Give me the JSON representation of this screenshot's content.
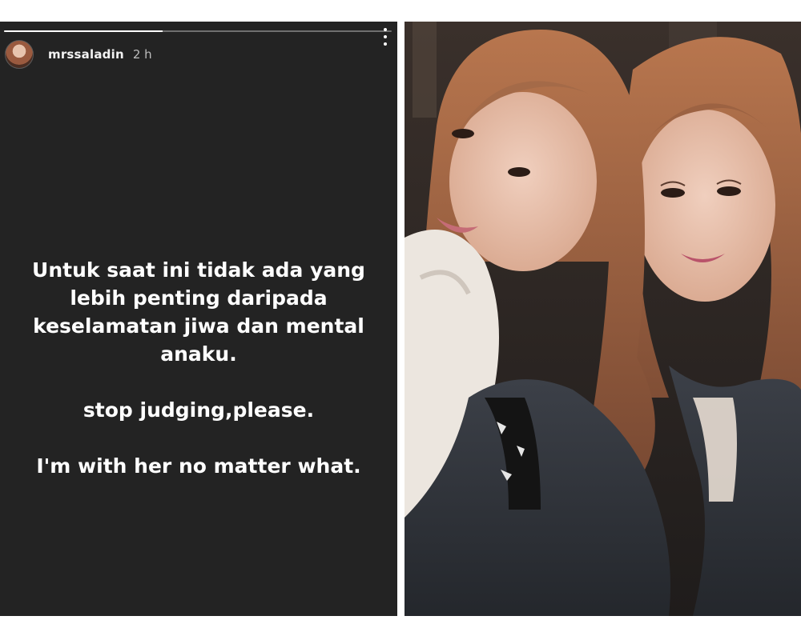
{
  "story": {
    "username": "mrssaladin",
    "time_ago": "2 h",
    "progress_fraction": 0.41,
    "lines": [
      "Untuk saat ini tidak ada yang",
      "lebih penting daripada",
      "keselamatan jiwa dan mental",
      "anaku.",
      "stop judging,please.",
      "I'm with her no matter what."
    ]
  },
  "photo": {
    "description_icon": "selfie-photo"
  },
  "colors": {
    "story_background": "#232323",
    "page_background": "#ffffff"
  }
}
